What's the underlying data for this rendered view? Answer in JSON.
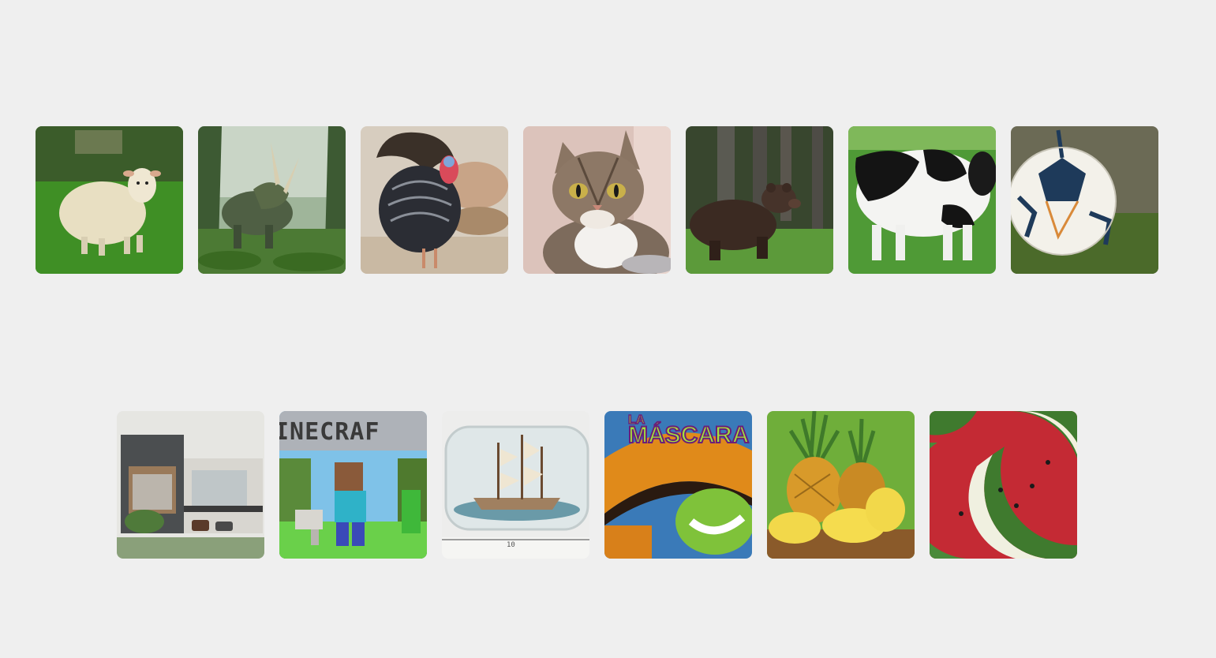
{
  "grid": {
    "row1": [
      {
        "icon": "sheep-icon"
      },
      {
        "icon": "triceratops-icon"
      },
      {
        "icon": "turkey-icon"
      },
      {
        "icon": "cat-icon"
      },
      {
        "icon": "bear-icon"
      },
      {
        "icon": "cow-icon"
      },
      {
        "icon": "soccer-ball-icon"
      }
    ],
    "row2": [
      {
        "icon": "modern-house-icon"
      },
      {
        "icon": "minecraft-icon",
        "text": "INECRAF"
      },
      {
        "icon": "ship-in-bottle-icon",
        "text": "10"
      },
      {
        "icon": "the-mask-movie-icon",
        "text": "MÁSCARA",
        "text2": "LA"
      },
      {
        "icon": "pineapple-icon"
      },
      {
        "icon": "watermelon-icon"
      }
    ]
  },
  "colors": {
    "background": "#efefef"
  }
}
